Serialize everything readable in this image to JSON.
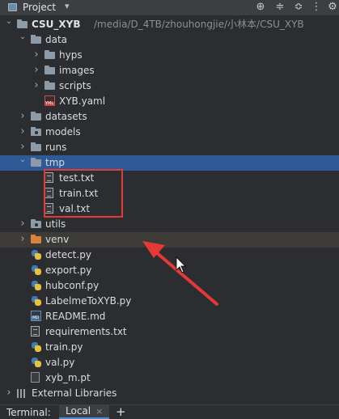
{
  "header": {
    "title": "Project",
    "chevron": "▾",
    "buttons": [
      {
        "name": "locate-icon",
        "glyph": "⊕"
      },
      {
        "name": "collapse-all-icon",
        "glyph": "≑"
      },
      {
        "name": "expand-all-icon",
        "glyph": "≎"
      },
      {
        "name": "more-icon",
        "glyph": "⋮"
      },
      {
        "name": "gear-icon",
        "glyph": "⚙"
      }
    ]
  },
  "tree": [
    {
      "label": "CSU_XYB",
      "path": "/media/D_4TB/zhouhongjie/小林本/CSU_XYB",
      "depth": 0,
      "arrow": "down",
      "icon": "folder",
      "bold": true
    },
    {
      "label": "data",
      "depth": 1,
      "arrow": "down",
      "icon": "folder"
    },
    {
      "label": "hyps",
      "depth": 2,
      "arrow": "right",
      "icon": "folder"
    },
    {
      "label": "images",
      "depth": 2,
      "arrow": "right",
      "icon": "folder"
    },
    {
      "label": "scripts",
      "depth": 2,
      "arrow": "right",
      "icon": "folder"
    },
    {
      "label": "XYB.yaml",
      "depth": 2,
      "arrow": "none",
      "icon": "yaml"
    },
    {
      "label": "datasets",
      "depth": 1,
      "arrow": "right",
      "icon": "folder"
    },
    {
      "label": "models",
      "depth": 1,
      "arrow": "right",
      "icon": "folder-pkg"
    },
    {
      "label": "runs",
      "depth": 1,
      "arrow": "right",
      "icon": "folder"
    },
    {
      "label": "tmp",
      "depth": 1,
      "arrow": "down",
      "icon": "folder",
      "selected": true
    },
    {
      "label": "test.txt",
      "depth": 2,
      "arrow": "none",
      "icon": "file"
    },
    {
      "label": "train.txt",
      "depth": 2,
      "arrow": "none",
      "icon": "file"
    },
    {
      "label": "val.txt",
      "depth": 2,
      "arrow": "none",
      "icon": "file"
    },
    {
      "label": "utils",
      "depth": 1,
      "arrow": "right",
      "icon": "folder-pkg"
    },
    {
      "label": "venv",
      "depth": 1,
      "arrow": "right",
      "icon": "folder-orange",
      "hover": true
    },
    {
      "label": "detect.py",
      "depth": 1,
      "arrow": "none",
      "icon": "py"
    },
    {
      "label": "export.py",
      "depth": 1,
      "arrow": "none",
      "icon": "py"
    },
    {
      "label": "hubconf.py",
      "depth": 1,
      "arrow": "none",
      "icon": "py"
    },
    {
      "label": "LabelmeToXYB.py",
      "depth": 1,
      "arrow": "none",
      "icon": "py"
    },
    {
      "label": "README.md",
      "depth": 1,
      "arrow": "none",
      "icon": "md"
    },
    {
      "label": "requirements.txt",
      "depth": 1,
      "arrow": "none",
      "icon": "file"
    },
    {
      "label": "train.py",
      "depth": 1,
      "arrow": "none",
      "icon": "py"
    },
    {
      "label": "val.py",
      "depth": 1,
      "arrow": "none",
      "icon": "py"
    },
    {
      "label": "xyb_m.pt",
      "depth": 1,
      "arrow": "none",
      "icon": "pt"
    },
    {
      "label": "External Libraries",
      "depth": 0,
      "arrow": "right",
      "icon": "lib"
    }
  ],
  "terminal": {
    "label": "Terminal:",
    "tab_label": "Local",
    "close_glyph": "×",
    "add_glyph": "+"
  },
  "colors": {
    "background": "#2b2d30",
    "selection": "#2e5a95",
    "annotation": "#e53935",
    "venv_folder": "#d8823b"
  }
}
